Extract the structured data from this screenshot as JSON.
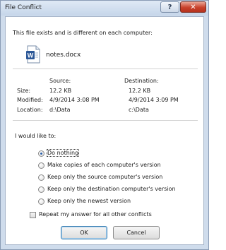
{
  "window": {
    "title": "File Conflict",
    "help_glyph": "?",
    "close_glyph": "✕"
  },
  "message": "This file exists and is different on each computer:",
  "file": {
    "name": "notes.docx",
    "icon": "word-document-icon"
  },
  "comparison": {
    "source_header": "Source:",
    "destination_header": "Destination:",
    "rows": [
      {
        "label": "Size:",
        "source": "12.2 KB",
        "destination": "12.2 KB"
      },
      {
        "label": "Modified:",
        "source": "4/9/2014 3:08 PM",
        "destination": "4/9/2014 3:09 PM"
      },
      {
        "label": "Location:",
        "source": "d:\\Data",
        "destination": "c:\\Data"
      }
    ]
  },
  "prompt": "I would like to:",
  "options": [
    {
      "label": "Do nothing",
      "selected": true
    },
    {
      "label": "Make copies of each computer's version",
      "selected": false
    },
    {
      "label": "Keep only the source computer's version",
      "selected": false
    },
    {
      "label": "Keep only the destination computer's version",
      "selected": false
    },
    {
      "label": "Keep only the newest version",
      "selected": false
    }
  ],
  "repeat_checkbox": {
    "label": "Repeat my answer for all other conflicts",
    "checked": false
  },
  "buttons": {
    "ok": "OK",
    "cancel": "Cancel"
  },
  "colors": {
    "accent": "#3c7fb1",
    "close": "#c8412b",
    "frame": "#cfdcec"
  }
}
